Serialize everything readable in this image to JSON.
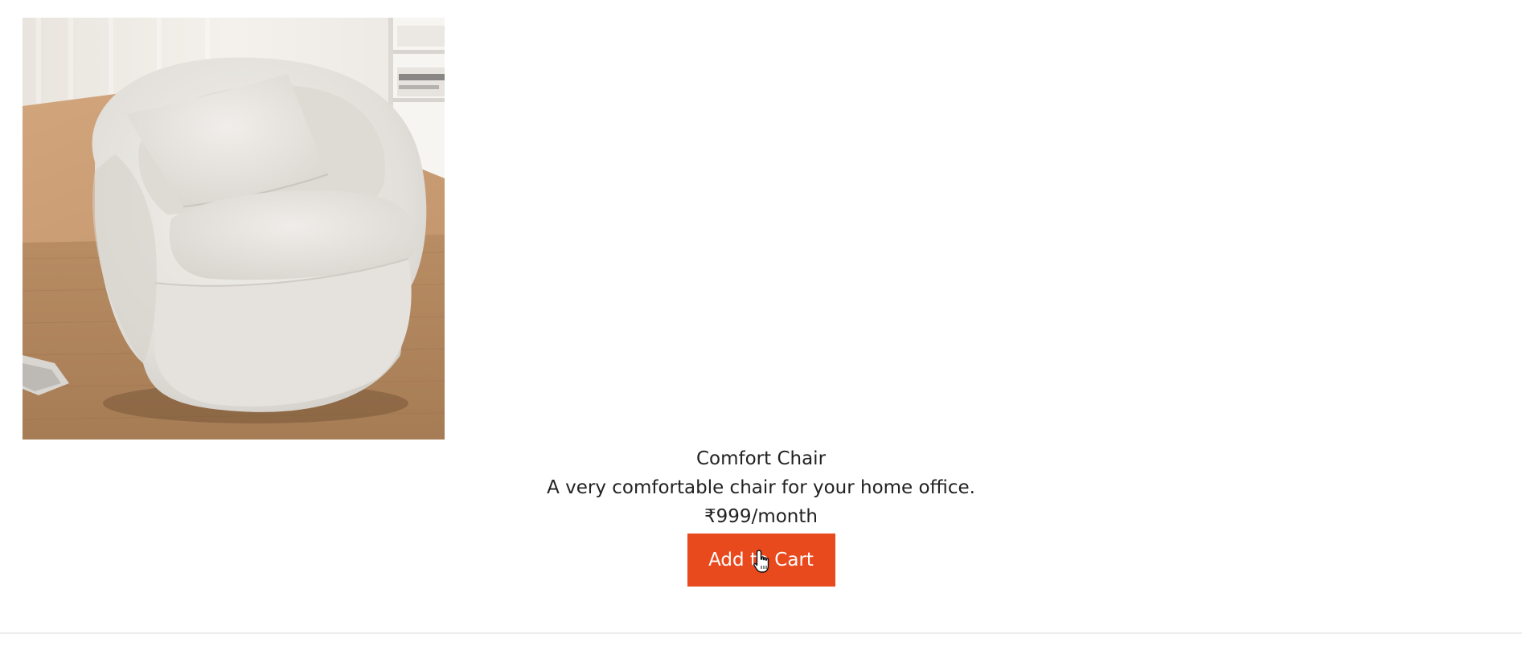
{
  "product": {
    "image_alt": "Comfort Chair",
    "name": "Comfort Chair",
    "description": "A very comfortable chair for your home office.",
    "price": "₹999/month",
    "add_to_cart_label": "Add to Cart"
  },
  "colors": {
    "button_bg": "#e8491d",
    "button_text": "#ffffff",
    "text": "#222222"
  },
  "icons": {
    "cursor": "hand-pointer-icon"
  }
}
